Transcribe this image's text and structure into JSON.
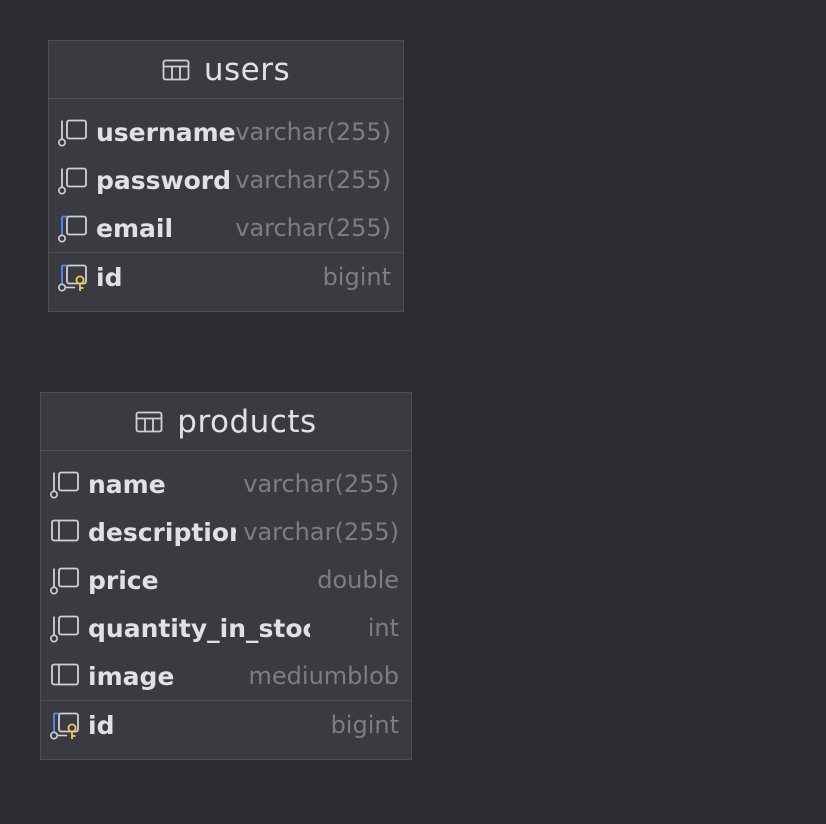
{
  "colors": {
    "background": "#2b2d31",
    "table_body": "#393b40",
    "border": "#4e5157",
    "name_text": "#dfe1e5",
    "type_text": "#7b7e85",
    "icon_stroke": "#cfd1d5",
    "index_accent": "#548af7",
    "key_accent": "#f2c55c"
  },
  "tables": [
    {
      "name": "users",
      "icon": "table-icon",
      "columns": [
        {
          "name": "username",
          "type": "varchar(255)",
          "icon": "column-not-null-icon"
        },
        {
          "name": "password",
          "type": "varchar(255)",
          "icon": "column-not-null-icon"
        },
        {
          "name": "email",
          "type": "varchar(255)",
          "icon": "column-indexed-icon"
        }
      ],
      "primary_key": {
        "name": "id",
        "type": "bigint",
        "icon": "primary-key-icon"
      }
    },
    {
      "name": "products",
      "icon": "table-icon",
      "columns": [
        {
          "name": "name",
          "type": "varchar(255)",
          "icon": "column-not-null-icon"
        },
        {
          "name": "description",
          "type": "varchar(255)",
          "icon": "column-nullable-icon"
        },
        {
          "name": "price",
          "type": "double",
          "icon": "column-not-null-icon"
        },
        {
          "name": "quantity_in_stock",
          "type": "int",
          "icon": "column-not-null-icon"
        },
        {
          "name": "image",
          "type": "mediumblob",
          "icon": "column-nullable-icon"
        }
      ],
      "primary_key": {
        "name": "id",
        "type": "bigint",
        "icon": "primary-key-icon"
      }
    }
  ]
}
